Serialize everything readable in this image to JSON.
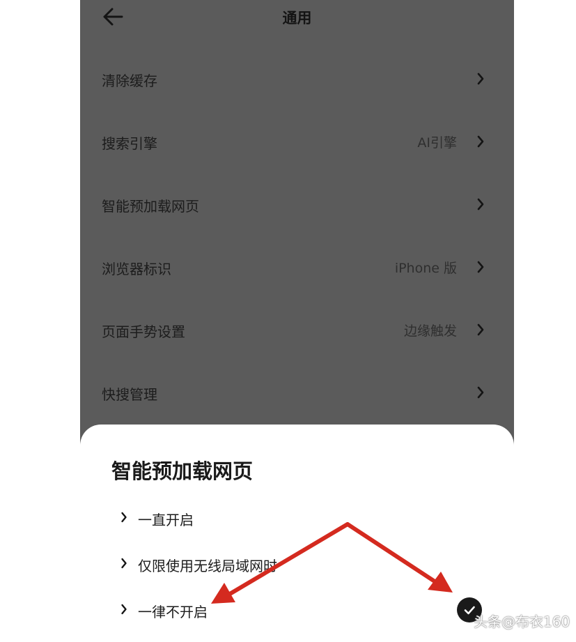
{
  "header": {
    "title": "通用",
    "back_icon": "arrow-left-icon"
  },
  "settings": [
    {
      "label": "清除缓存",
      "value": ""
    },
    {
      "label": "搜索引擎",
      "value": "AI引擎"
    },
    {
      "label": "智能预加载网页",
      "value": ""
    },
    {
      "label": "浏览器标识",
      "value": "iPhone 版"
    },
    {
      "label": "页面手势设置",
      "value": "边缘触发"
    },
    {
      "label": "快搜管理",
      "value": ""
    }
  ],
  "sheet": {
    "title": "智能预加载网页",
    "options": [
      {
        "label": "一直开启",
        "selected": false
      },
      {
        "label": "仅限使用无线局域网时",
        "selected": false
      },
      {
        "label": "一律不开启",
        "selected": true
      }
    ]
  },
  "watermark": "头条@布衣160",
  "colors": {
    "overlay_gray": "#5b5b5b",
    "sheet_bg": "#ffffff",
    "check_bg": "#1a1a1a",
    "annotation_arrow": "#d42a1f"
  }
}
